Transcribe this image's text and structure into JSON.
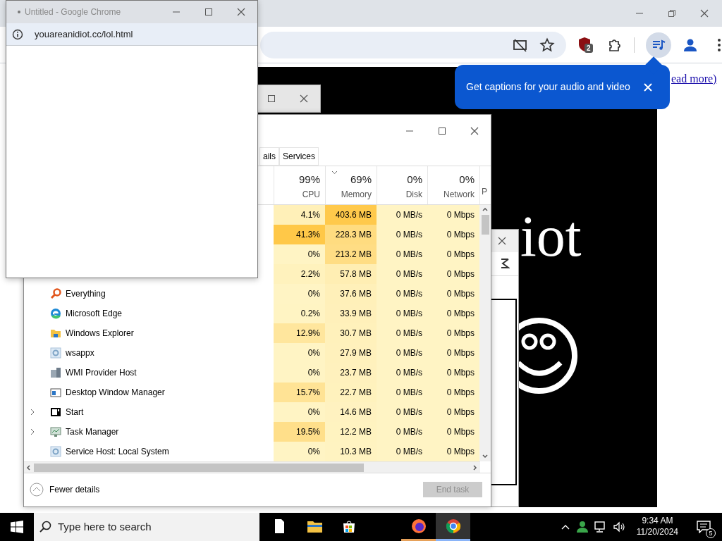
{
  "browser": {
    "extension_badge": "2",
    "page_link": "ead more)",
    "page_heading": "iot"
  },
  "caption_bubble": {
    "text": "Get captions for your audio and video"
  },
  "popup_window": {
    "title": "Untitled - Google Chrome",
    "url": "youareanidiot.cc/lol.html"
  },
  "task_manager": {
    "tabs": [
      {
        "label": "ails",
        "selected": false
      },
      {
        "label": "Services",
        "selected": false
      }
    ],
    "columns": [
      {
        "percent": "99%",
        "label": "CPU",
        "sorted": false
      },
      {
        "percent": "69%",
        "label": "Memory",
        "sorted": true
      },
      {
        "percent": "0%",
        "label": "Disk",
        "sorted": false
      },
      {
        "percent": "0%",
        "label": "Network",
        "sorted": false
      },
      {
        "label": "P"
      }
    ],
    "rows": [
      {
        "kind": "hidden",
        "cpu": "4.1%",
        "memory": "403.6 MB",
        "disk": "0 MB/s",
        "network": "0 Mbps"
      },
      {
        "kind": "hidden",
        "cpu": "41.3%",
        "memory": "228.3 MB",
        "disk": "0 MB/s",
        "network": "0 Mbps"
      },
      {
        "kind": "hidden",
        "cpu": "0%",
        "memory": "213.2 MB",
        "disk": "0 MB/s",
        "network": "0 Mbps"
      },
      {
        "kind": "hidden",
        "cpu": "2.2%",
        "memory": "57.8 MB",
        "disk": "0 MB/s",
        "network": "0 Mbps"
      },
      {
        "kind": "magnifier",
        "name": "Everything",
        "expandable": false,
        "cpu": "0%",
        "memory": "37.6 MB",
        "disk": "0 MB/s",
        "network": "0 Mbps"
      },
      {
        "kind": "edge",
        "name": "Microsoft Edge",
        "expandable": false,
        "cpu": "0.2%",
        "memory": "33.9 MB",
        "disk": "0 MB/s",
        "network": "0 Mbps"
      },
      {
        "kind": "folder",
        "name": "Windows Explorer",
        "expandable": false,
        "cpu": "12.9%",
        "memory": "30.7 MB",
        "disk": "0 MB/s",
        "network": "0 Mbps"
      },
      {
        "kind": "gear",
        "name": "wsappx",
        "expandable": false,
        "cpu": "0%",
        "memory": "27.9 MB",
        "disk": "0 MB/s",
        "network": "0 Mbps"
      },
      {
        "kind": "server",
        "name": "WMI Provider Host",
        "expandable": false,
        "cpu": "0%",
        "memory": "23.7 MB",
        "disk": "0 MB/s",
        "network": "0 Mbps"
      },
      {
        "kind": "window",
        "name": "Desktop Window Manager",
        "expandable": false,
        "cpu": "15.7%",
        "memory": "22.7 MB",
        "disk": "0 MB/s",
        "network": "0 Mbps"
      },
      {
        "kind": "start",
        "name": "Start",
        "expandable": true,
        "cpu": "0%",
        "memory": "14.6 MB",
        "disk": "0 MB/s",
        "network": "0 Mbps"
      },
      {
        "kind": "monitor",
        "name": "Task Manager",
        "expandable": true,
        "cpu": "19.5%",
        "memory": "12.2 MB",
        "disk": "0 MB/s",
        "network": "0 Mbps"
      },
      {
        "kind": "gear",
        "name": "Service Host: Local System",
        "expandable": false,
        "cpu": "0%",
        "memory": "10.3 MB",
        "disk": "0 MB/s",
        "network": "0 Mbps"
      }
    ],
    "fewer_details": "Fewer details",
    "end_task": {
      "label": "End task",
      "disabled": true
    }
  },
  "taskbar": {
    "search_placeholder": "Type here to search",
    "apps": [
      {
        "kind": "file",
        "running": false,
        "selected": false
      },
      {
        "kind": "explorer",
        "running": false,
        "selected": false
      },
      {
        "kind": "store",
        "running": false,
        "selected": false
      },
      {
        "kind": "firefox",
        "running": true,
        "selected": false
      },
      {
        "kind": "chrome",
        "running": true,
        "selected": true
      }
    ],
    "time": "9:34 AM",
    "date": "11/20/2024",
    "notification_count": "5"
  }
}
